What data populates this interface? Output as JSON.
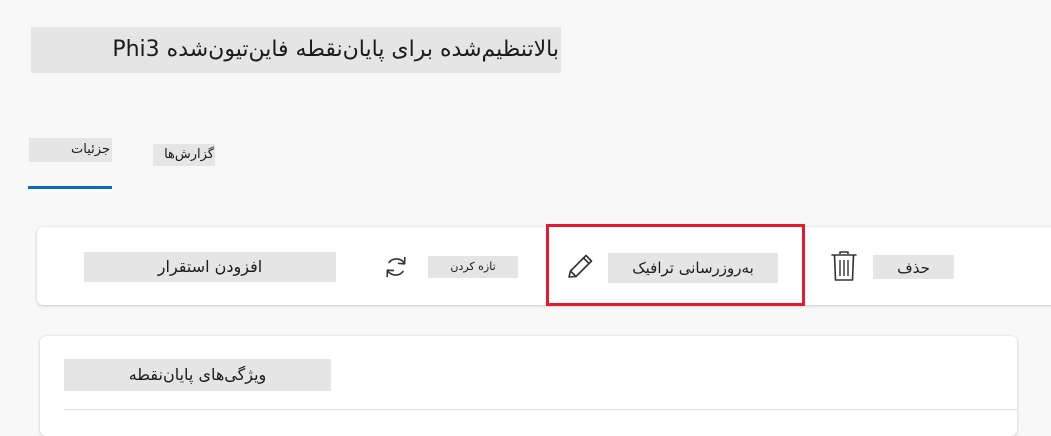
{
  "page": {
    "title": "بالاتنظیم‌شده برای پایان‌نقطه فاین‌تیون‌شده Phi3"
  },
  "tabs": [
    {
      "label": "جزئیات",
      "selected": true
    },
    {
      "label": "گزارش‌ها",
      "selected": false
    }
  ],
  "toolbar": {
    "add_deployment_label": "افزودن استقرار",
    "refresh_label": "تازه کردن",
    "refresh_icon": "refresh-icon",
    "update_traffic_label": "به‌روزرسانی ترافیک",
    "update_traffic_icon": "pencil-icon",
    "delete_label": "حذف",
    "delete_icon": "trash-icon"
  },
  "card": {
    "title": "ویژگی‌های پایان‌نقطه"
  },
  "colors": {
    "accent": "#0f6cbd",
    "highlight": "#e51a2a",
    "label_background": "#e5e5e5",
    "page_background": "#f8f8f8"
  }
}
